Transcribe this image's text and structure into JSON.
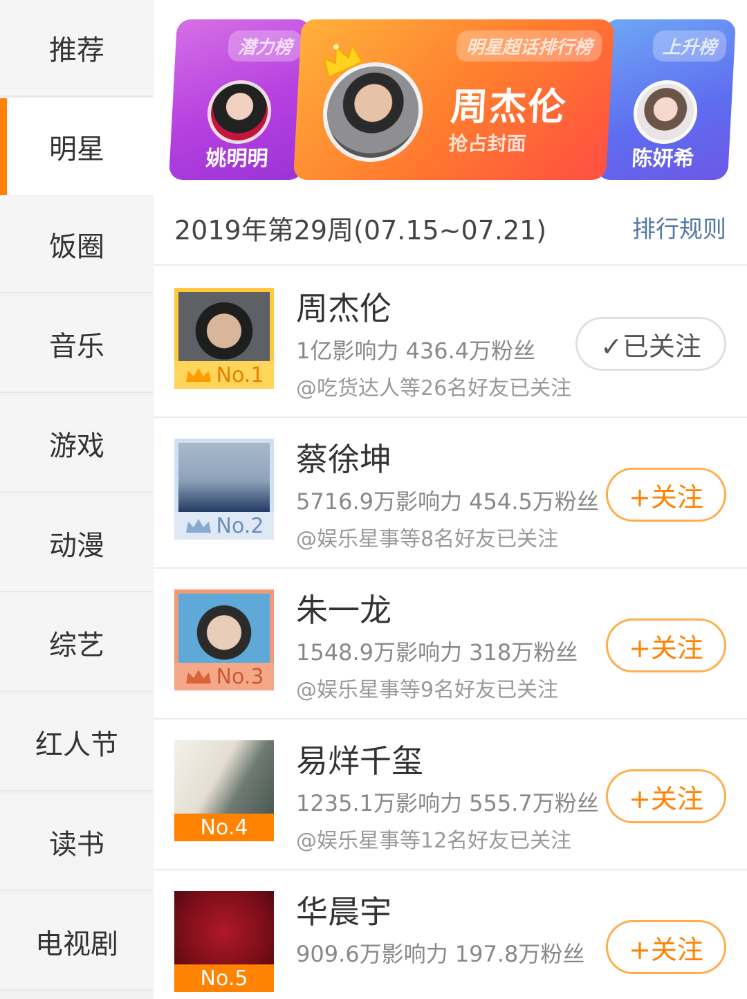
{
  "sidebar": {
    "items": [
      {
        "label": "推荐",
        "active": false
      },
      {
        "label": "明星",
        "active": true
      },
      {
        "label": "饭圈",
        "active": false
      },
      {
        "label": "音乐",
        "active": false
      },
      {
        "label": "游戏",
        "active": false
      },
      {
        "label": "动漫",
        "active": false
      },
      {
        "label": "综艺",
        "active": false
      },
      {
        "label": "红人节",
        "active": false
      },
      {
        "label": "读书",
        "active": false
      },
      {
        "label": "电视剧",
        "active": false
      }
    ]
  },
  "banner": {
    "left": {
      "tag": "潜力榜",
      "name": "姚明明"
    },
    "center": {
      "tag": "明星超话排行榜",
      "name": "周杰伦",
      "subtitle": "抢占封面"
    },
    "right": {
      "tag": "上升榜",
      "name": "陈妍希"
    }
  },
  "period": {
    "text": "2019年第29周(07.15~07.21)",
    "rules_label": "排行规则"
  },
  "rankings": [
    {
      "rank": "No.1",
      "name": "周杰伦",
      "stats": "1亿影响力 436.4万粉丝",
      "friends": "@吃货达人等26名好友已关注",
      "button": "✓已关注",
      "followed": true
    },
    {
      "rank": "No.2",
      "name": "蔡徐坤",
      "stats": "5716.9万影响力 454.5万粉丝",
      "friends": "@娱乐星事等8名好友已关注",
      "button": "+关注",
      "followed": false
    },
    {
      "rank": "No.3",
      "name": "朱一龙",
      "stats": "1548.9万影响力 318万粉丝",
      "friends": "@娱乐星事等9名好友已关注",
      "button": "+关注",
      "followed": false
    },
    {
      "rank": "No.4",
      "name": "易烊千玺",
      "stats": "1235.1万影响力 555.7万粉丝",
      "friends": "@娱乐星事等12名好友已关注",
      "button": "+关注",
      "followed": false
    },
    {
      "rank": "No.5",
      "name": "华晨宇",
      "stats": "909.6万影响力 197.8万粉丝",
      "friends": "",
      "button": "+关注",
      "followed": false
    }
  ],
  "colors": {
    "accent": "#ff8200",
    "link": "#5477a6"
  }
}
